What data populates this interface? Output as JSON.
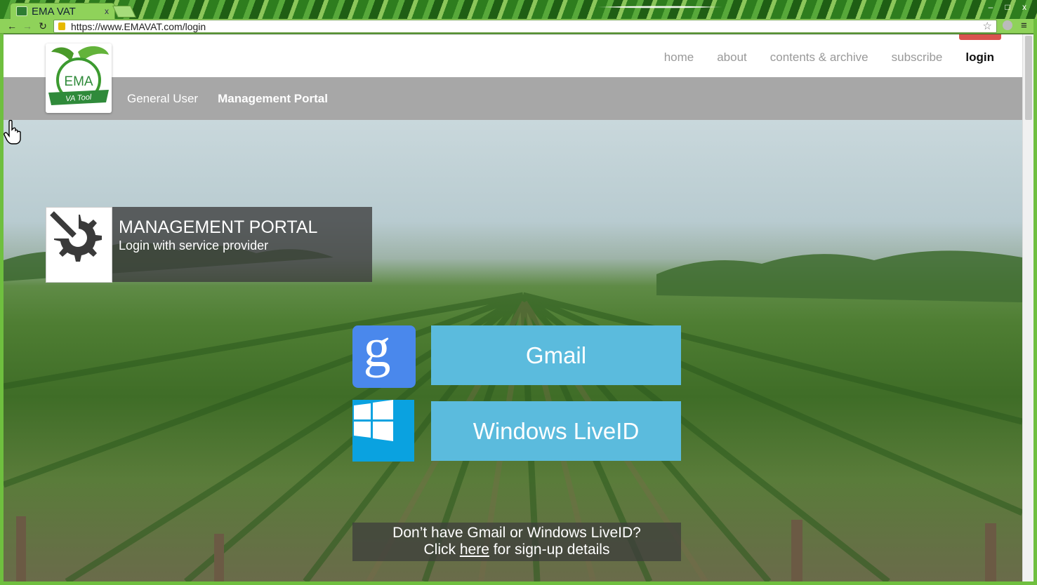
{
  "browser": {
    "tab_title": "EMA VAT",
    "tab_close": "x",
    "url": "https://www.EMAVAT.com/login",
    "window_buttons": [
      "–",
      "□",
      "x"
    ]
  },
  "site": {
    "logo": {
      "line1": "EMA",
      "line2": "VA Tool"
    },
    "topnav": [
      {
        "label": "home"
      },
      {
        "label": "about"
      },
      {
        "label": "contents & archive"
      },
      {
        "label": "subscribe"
      },
      {
        "label": "login",
        "active": true
      }
    ],
    "subnav": [
      {
        "label": "General User"
      },
      {
        "label": "Management Portal",
        "current": true
      }
    ]
  },
  "portal": {
    "title": "MANAGEMENT PORTAL",
    "subtitle": "Login with service provider"
  },
  "providers": {
    "gmail": {
      "label": "Gmail",
      "icon": "google-icon"
    },
    "windows": {
      "label": "Windows LiveID",
      "icon": "windows-icon"
    }
  },
  "signup": {
    "line1": "Don’t have Gmail or Windows LiveID?",
    "line2_before": "Click",
    "link": "here",
    "line2_after": "for sign-up details"
  },
  "colors": {
    "accent_button": "#5bbbdd",
    "google_blue": "#4a88ec",
    "windows_blue": "#0aa2e0",
    "subnav_gray": "#a7a7a7",
    "browser_green": "#8fd25a"
  }
}
